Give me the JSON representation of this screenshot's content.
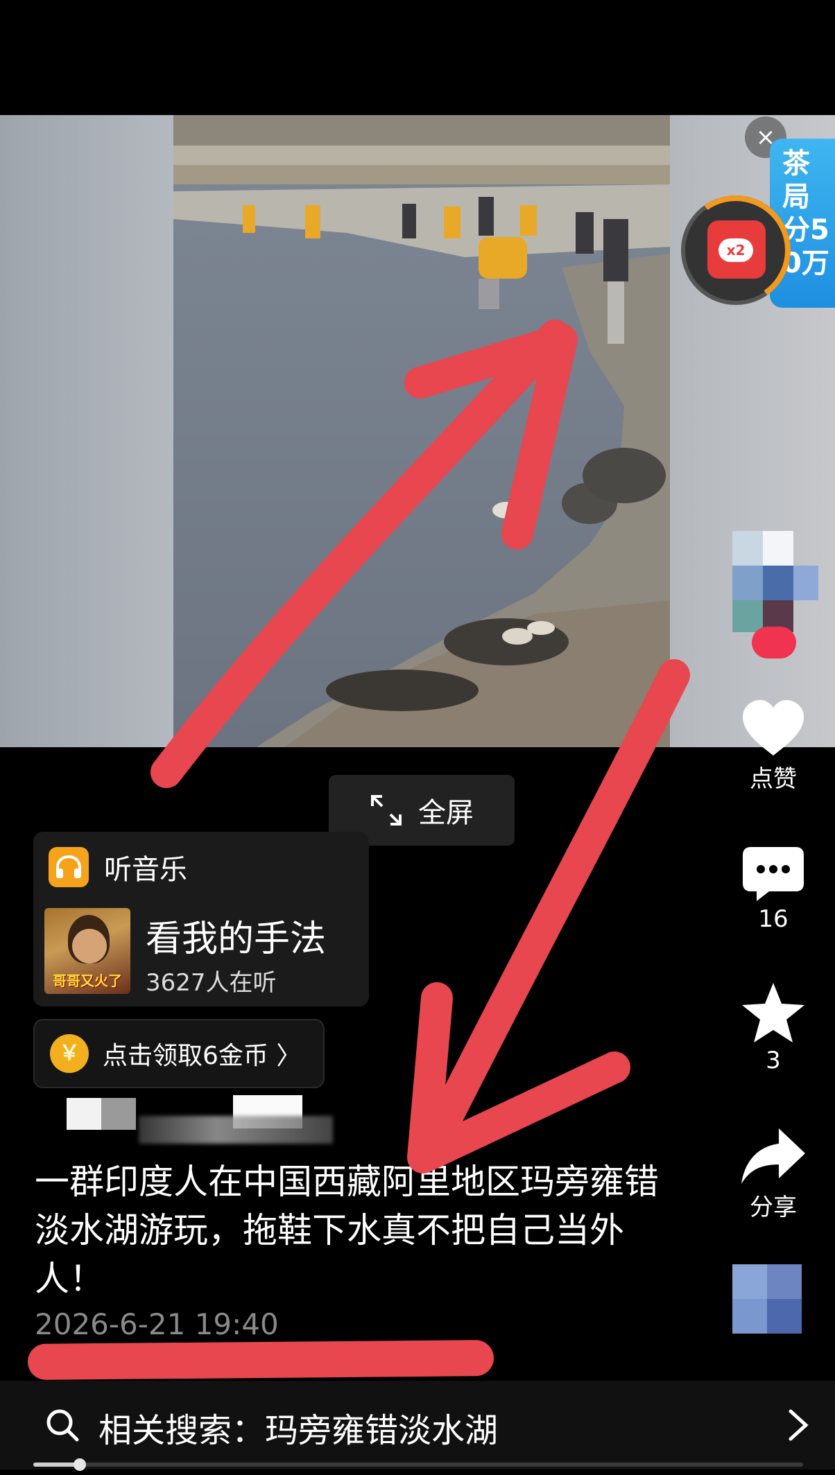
{
  "promo": {
    "close_glyph": "×",
    "banner_text": "茶局分50万",
    "multiplier_badge": "x2"
  },
  "actions": {
    "like_label": "点赞",
    "comment_count": "16",
    "favorite_count": "3",
    "share_label": "分享"
  },
  "fullscreen": {
    "label": "全屏"
  },
  "music": {
    "header_label": "听音乐",
    "cover_caption": "哥哥又火了",
    "song_title": "看我的手法",
    "listeners": "3627人在听"
  },
  "coins": {
    "label": "点击领取6金币 〉"
  },
  "post": {
    "caption": "一群印度人在中国西藏阿里地区玛旁雍错淡水湖游玩，拖鞋下水真不把自己当外人！",
    "timestamp": "2026-6-21 19:40"
  },
  "search": {
    "label": "相关搜索：玛旁雍错淡水湖"
  },
  "playback": {
    "progress_fraction": 0.06
  },
  "colors": {
    "like_red": "#e8474f",
    "coin_gold": "#f2b01e",
    "music_orange": "#f7a21b",
    "promo_blue": "#2a9fe8"
  },
  "icons": [
    "close-icon",
    "red-packet-icon",
    "heart-icon",
    "comment-icon",
    "star-icon",
    "share-icon",
    "expand-icon",
    "headphones-icon",
    "coin-icon",
    "search-icon",
    "chevron-right-icon"
  ]
}
